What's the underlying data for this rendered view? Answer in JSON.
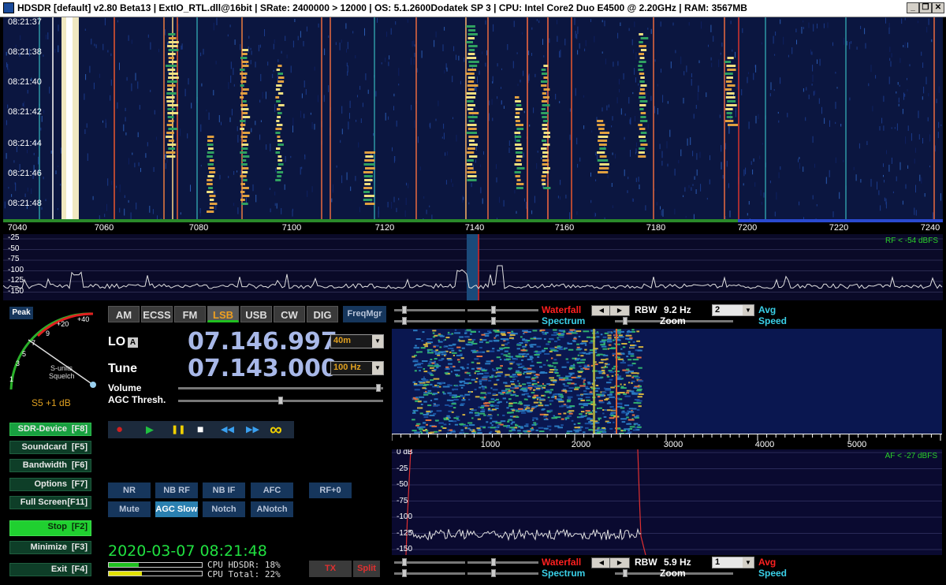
{
  "titlebar": {
    "title": "HDSDR  [default]  v2.80 Beta13  |  ExtIO_RTL.dll@16bit  |  SRate: 2400000 > 12000  |  OS: 5.1.2600Dodatek  SP 3  |  CPU: Intel Core2 Duo     E4500  @ 2.20GHz  |  RAM: 3567MB",
    "minimize_glyph": "_",
    "restore_glyph": "❐",
    "close_glyph": "✕"
  },
  "waterfall": {
    "time_labels": [
      "08:21:37",
      "08:21:38",
      "08:21:40",
      "08:21:42",
      "08:21:44",
      "08:21:46",
      "08:21:48"
    ],
    "freq_labels": [
      "7040",
      "7060",
      "7080",
      "7100",
      "7120",
      "7140",
      "7160",
      "7180",
      "7200",
      "7220",
      "7240"
    ],
    "rf_level": "RF < -54 dBFS",
    "db_labels": [
      "-25",
      "-50",
      "-75",
      "-100",
      "-125",
      "-150"
    ]
  },
  "smeter": {
    "scale_labels": [
      "1",
      "3",
      "5",
      "7",
      "9",
      "+20",
      "+40"
    ],
    "units_label": "S-units",
    "squelch_label": "Squelch",
    "reading": "S5 +1 dB",
    "peak_label": "Peak"
  },
  "left_buttons": [
    {
      "name": "SDR-Device",
      "key": "[F8]",
      "style": "active"
    },
    {
      "name": "Soundcard",
      "key": "[F5]",
      "style": "normal"
    },
    {
      "name": "Bandwidth",
      "key": "[F6]",
      "style": "normal"
    },
    {
      "name": "Options",
      "key": "[F7]",
      "style": "normal"
    },
    {
      "name": "Full Screen",
      "key": "[F11]",
      "style": "normal"
    },
    {
      "name": "Stop",
      "key": "[F2]",
      "style": "bright"
    },
    {
      "name": "Minimize",
      "key": "[F3]",
      "style": "normal"
    },
    {
      "name": "Exit",
      "key": "[F4]",
      "style": "normal"
    }
  ],
  "modes": [
    "AM",
    "ECSS",
    "FM",
    "LSB",
    "USB",
    "CW",
    "DIG"
  ],
  "active_mode": "LSB",
  "freqmgr_label": "FreqMgr",
  "lo": {
    "label": "LO",
    "badge": "A",
    "value": "07.146.997",
    "band": "40m"
  },
  "tune": {
    "label": "Tune",
    "value": "07.143.000",
    "step": "100 Hz"
  },
  "volume_label": "Volume",
  "volume_level": 0.99,
  "agc_label": "AGC Thresh.",
  "agc_level": 0.5,
  "transport": {
    "record": "●",
    "play": "▶",
    "pause": "❚❚",
    "stop": "■",
    "rewind": "◀◀",
    "forward": "▶▶",
    "loop": "∞"
  },
  "dsp_row1": [
    "NR",
    "NB RF",
    "NB IF",
    "AFC",
    "RF+0"
  ],
  "dsp_row2": [
    "Mute",
    "AGC Slow",
    "Notch",
    "ANotch"
  ],
  "datetime": "2020-03-07 08:21:48",
  "cpu_hdsdr": "CPU HDSDR: 18%",
  "cpu_total": "CPU Total: 22%",
  "cpu_hdsdr_level": 0.18,
  "cpu_total_level": 0.22,
  "tx_label": "TX",
  "split_label": "Split",
  "top_panel": {
    "waterfall_label": "Waterfall",
    "spectrum_label": "Spectrum",
    "rbw_label": "RBW",
    "rbw_value": "9.2 Hz",
    "zoom_label": "Zoom",
    "avg_value": "2",
    "avg_label": "Avg",
    "speed_label": "Speed"
  },
  "bottom_panel": {
    "waterfall_label": "Waterfall",
    "spectrum_label": "Spectrum",
    "rbw_label": "RBW",
    "rbw_value": "5.9 Hz",
    "zoom_label": "Zoom",
    "avg_value": "1",
    "avg_label": "Avg",
    "speed_label": "Speed"
  },
  "audio": {
    "freq_labels": [
      "1000",
      "2000",
      "3000",
      "4000",
      "5000"
    ],
    "af_level": "AF < -27 dBFS",
    "db_labels": [
      "0 dB",
      "-25",
      "-50",
      "-75",
      "-100",
      "-125",
      "-150"
    ]
  },
  "colors": {
    "accent_cyan": "#3ad0e8",
    "accent_red": "#ff2020",
    "lcd": "#a8b8e8",
    "wf_bg": "#0b1640"
  }
}
